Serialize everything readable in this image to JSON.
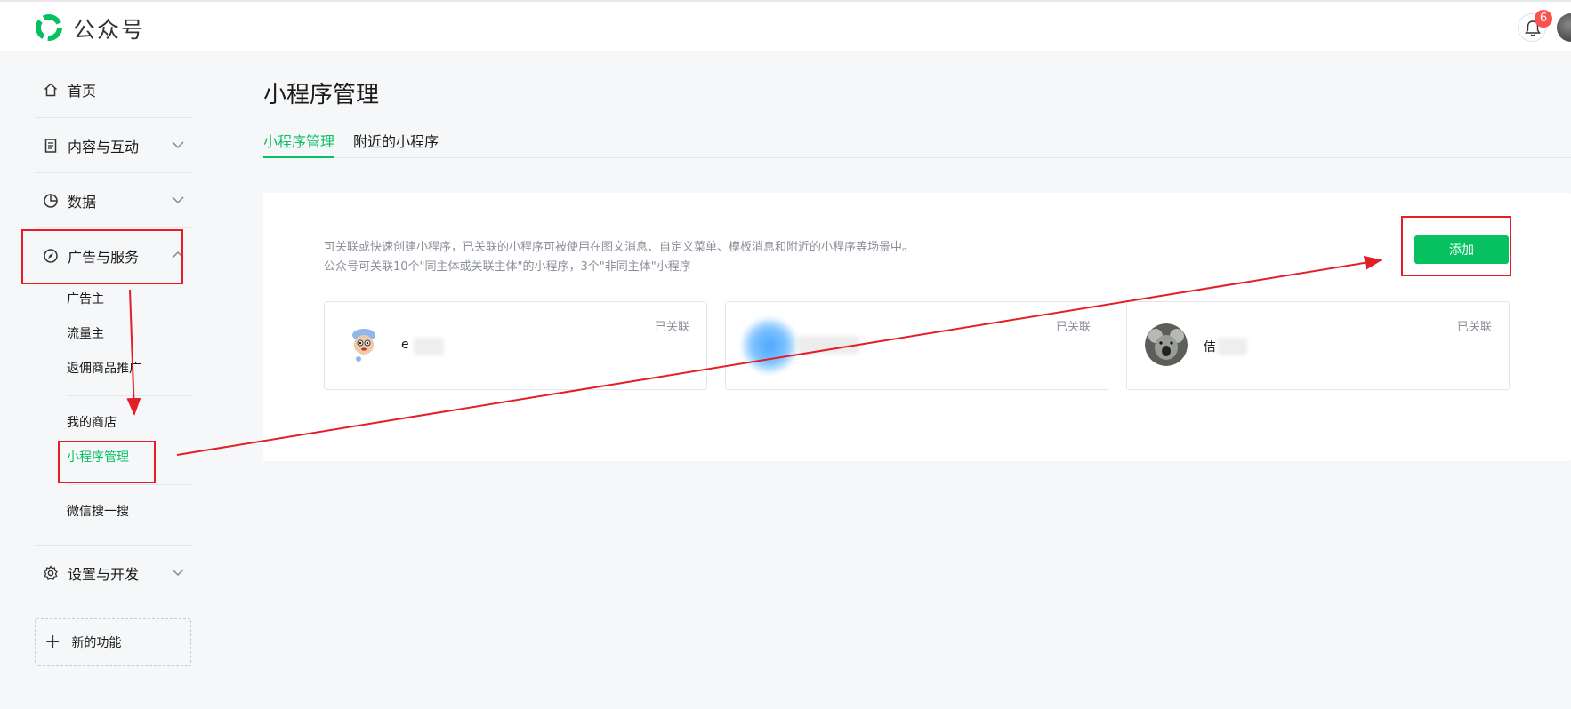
{
  "app": {
    "brand": "公众号"
  },
  "topbar": {
    "notification_count": "6",
    "icons": {
      "bell": "bell-icon",
      "avatar": "user-avatar"
    }
  },
  "sidebar": {
    "home": {
      "label": "首页",
      "icon": "home-icon"
    },
    "content": {
      "label": "内容与互动",
      "icon": "document-icon"
    },
    "data": {
      "label": "数据",
      "icon": "pie-chart-icon"
    },
    "ads": {
      "label": "广告与服务",
      "icon": "compass-icon",
      "items": [
        "广告主",
        "流量主",
        "返佣商品推广",
        "我的商店",
        "小程序管理",
        "微信搜一搜"
      ]
    },
    "settings": {
      "label": "设置与开发",
      "icon": "gear-icon"
    },
    "new_feature": "新的功能"
  },
  "main": {
    "title": "小程序管理",
    "tabs": [
      "小程序管理",
      "附近的小程序"
    ],
    "description_line1": "可关联或快速创建小程序，已关联的小程序可被使用在图文消息、自定义菜单、模板消息和附近的小程序等场景中。",
    "description_line2": "公众号可关联10个\"同主体或关联主体\"的小程序，3个\"非同主体\"小程序",
    "add_button": "添加",
    "cards": [
      {
        "name": "e",
        "status": "已关联"
      },
      {
        "name": "",
        "status": "已关联"
      },
      {
        "name": "佶",
        "status": "已关联"
      }
    ]
  },
  "colors": {
    "accent": "#07c160",
    "annotation": "#e41e26",
    "badge": "#fa5151"
  }
}
